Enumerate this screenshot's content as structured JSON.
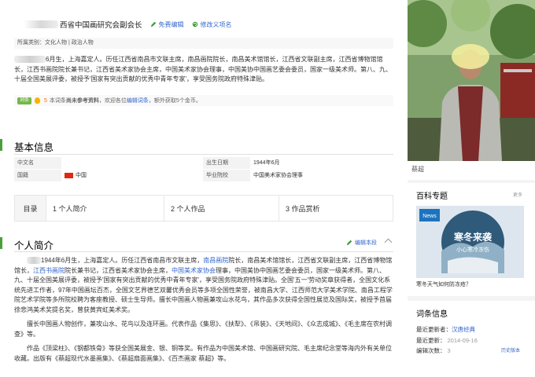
{
  "header": {
    "title": "西省中国画研究会副会长",
    "free_edit": "免费编辑",
    "modify_name": "修改义项名"
  },
  "categories": "所属类别：文化人物 | 政治人物",
  "summary": {
    "text": "6月生，上海嘉定人。历任江西省南昌市文联主席，南昌画院院长，南昌美术馆馆长，江西省文联副主席，江西省博物馆馆长，江西书画院院长兼书记，江西省美术家协会主席，中国美术家协会理事，中国美协中国画艺委会委员，国家一级美术师。第八、九、十届全国美展评委，被授予'国家有突出贡献的优秀中青年专家'，享受国务院政府特殊津贴。"
  },
  "notice": {
    "badge": "词条",
    "count": "5",
    "text_before": "本词条",
    "bold": "尚未参考资料",
    "text_middle": "，欢迎各位",
    "link": "编辑词条",
    "text_after": "，额外获取5个金币。"
  },
  "basic": {
    "title": "基本信息",
    "rows": [
      {
        "l1": "中文名",
        "v1": "",
        "l2": "出生日期",
        "v2": "1944年6月"
      },
      {
        "l1": "国籍",
        "v1": "中国",
        "l2": "毕业院校",
        "v2": "中国美术家协会理事"
      }
    ]
  },
  "toc": {
    "head": "目录",
    "items": [
      "1 个人简介",
      "2 个人作品",
      "3 作品赏析"
    ]
  },
  "intro": {
    "title": "个人简介",
    "edit_link": "编辑本段",
    "p1_a": "1944年6月生，上海嘉定人。历任江西省南昌市文联主席，",
    "p1_link1": "南昌画院",
    "p1_b": "院长，南昌美术馆馆长，江西省文联副主席，江西省博物馆馆长，",
    "p1_link2": "江西书画院",
    "p1_c": "院长兼书记，江西省美术家协会主席，",
    "p1_link3": "中国美术家协会",
    "p1_d": "理事，中国美协中国画艺委会委员，国家一级美术师。第八、九、十届全国美展评委，被授予'国家有突出贡献的优秀中青年专家'，享受国务院政府特殊津贴。全国'五一'劳动奖章获得者，全国文化系统先进工作者，97年中国画坛百杰，全国文艺界德艺双馨优秀会员等多项全国性荣誉，被南昌大学、江西师范大学美术学院、南昌工程学院艺术学院等多所院校聘为客座教授、硕士生导师。擅长中国画人物画兼攻山水花鸟，其作品多次获得全国性展览及国际奖，被授予首届徐悲鸿美术奖提名奖，曾获黄宾虹美术奖。",
    "p2": "擅长中国画人物创作，兼攻山水、花鸟以及连环画。代表作品《集思》、《扶犁》、《吊装》、《天地间》、《众志成城》、《毛主席在农村调查》等。",
    "p3": "作品《顶梁柱》、《钢都铁骨》等获全国美展金、银、铜等奖。有作品为中国美术馆、中国画研究院、毛主席纪念堂等海内外有关单位收藏。出版有《蔡超现代水墨画集》、《蔡超扇面画集》、《百杰画家 蔡超》等。"
  },
  "photo": {
    "caption": "蔡超"
  },
  "topic": {
    "title": "百科专题",
    "more": "更多",
    "banner_main": "寒冬来袭",
    "banner_sub": "小心寒冷冻伤",
    "logo": "News",
    "caption": "寒冬天气如何防冻疮？"
  },
  "record": {
    "title": "词条信息",
    "editor_label": "最近更新者：",
    "editor": "汉唐经典",
    "updated_label": "最近更新：",
    "updated": "2014-09-16",
    "count_label": "编辑次数：",
    "count": "3",
    "history": "历史版本"
  },
  "colors": {
    "link": "#3366cc",
    "accent_green": "#4b9f3b"
  }
}
